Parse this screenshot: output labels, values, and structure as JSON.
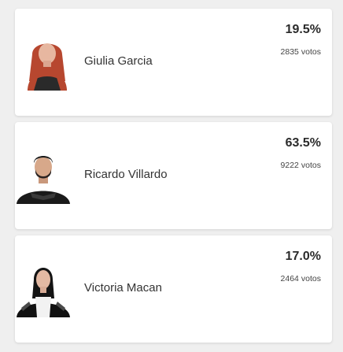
{
  "candidates": [
    {
      "name": "Giulia Garcia",
      "percent": "19.5%",
      "votes": "2835",
      "votes_label": "votos",
      "hair_color": "#b7472f",
      "outfit_color": "#2a2a2a"
    },
    {
      "name": "Ricardo Villardo",
      "percent": "63.5%",
      "votes": "9222",
      "votes_label": "votos",
      "hair_color": "#1b1b1b",
      "outfit_color": "#1a1a1a"
    },
    {
      "name": "Victoria Macan",
      "percent": "17.0%",
      "votes": "2464",
      "votes_label": "votos",
      "hair_color": "#141414",
      "outfit_color": "#111111"
    }
  ]
}
